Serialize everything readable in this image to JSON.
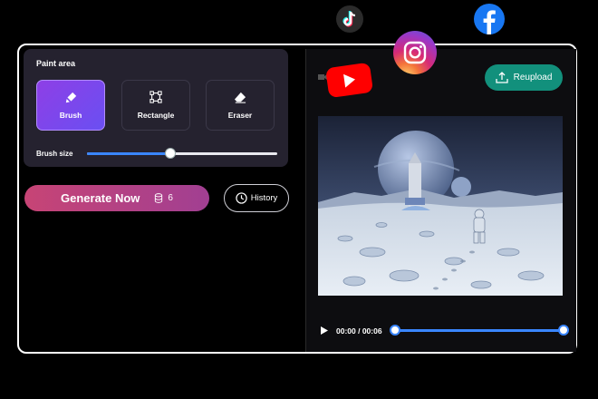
{
  "paint": {
    "title": "Paint area",
    "tools": [
      {
        "label": "Brush",
        "active": true
      },
      {
        "label": "Rectangle",
        "active": false
      },
      {
        "label": "Eraser",
        "active": false
      }
    ],
    "brush_size_label": "Brush size",
    "brush_size_fraction": 0.44
  },
  "generate": {
    "label": "Generate Now",
    "credits": "6"
  },
  "history": {
    "label": "History"
  },
  "preview": {
    "reupload_label": "Reupload",
    "time": "00:00 / 00:06",
    "progress_fraction": 0.0
  },
  "colors": {
    "accent_blue": "#3a86ff",
    "generate_start": "#c74475",
    "generate_end": "#a13f92",
    "reupload": "#12907c",
    "brush_active": "#8e3fe6"
  },
  "social_icons": [
    "tiktok-icon",
    "instagram-icon",
    "facebook-icon",
    "youtube-icon"
  ]
}
